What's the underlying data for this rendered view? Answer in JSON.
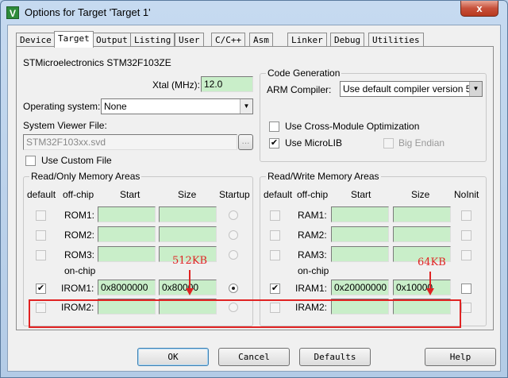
{
  "window": {
    "title": "Options for Target 'Target 1'",
    "close_glyph": "x"
  },
  "tabs": [
    {
      "label": "Device"
    },
    {
      "label": "Target"
    },
    {
      "label": "Output"
    },
    {
      "label": "Listing"
    },
    {
      "label": "User"
    },
    {
      "label": "C/C++"
    },
    {
      "label": "Asm"
    },
    {
      "label": "Linker"
    },
    {
      "label": "Debug"
    },
    {
      "label": "Utilities"
    }
  ],
  "active_tab": "Target",
  "device": {
    "name": "STMicroelectronics STM32F103ZE",
    "xtal_label": "Xtal (MHz):",
    "xtal_value": "12.0"
  },
  "os": {
    "label": "Operating system:",
    "value": "None"
  },
  "svd": {
    "label": "System Viewer File:",
    "value": "STM32F103xx.svd",
    "browse": "...",
    "custom_label": "Use Custom File"
  },
  "codegen": {
    "title": "Code Generation",
    "compiler_label": "ARM Compiler:",
    "compiler_value": "Use default compiler version 5",
    "cross_module_label": "Use Cross-Module Optimization",
    "microlib_label": "Use MicroLIB",
    "big_endian_label": "Big Endian"
  },
  "rom": {
    "title": "Read/Only Memory Areas",
    "headers": {
      "default": "default",
      "offchip": "off-chip",
      "start": "Start",
      "size": "Size",
      "startup": "Startup"
    },
    "onchip_label": "on-chip",
    "rows": [
      {
        "name": "ROM1:",
        "start": "",
        "size": "",
        "default": false,
        "startup": false
      },
      {
        "name": "ROM2:",
        "start": "",
        "size": "",
        "default": false,
        "startup": false
      },
      {
        "name": "ROM3:",
        "start": "",
        "size": "",
        "default": false,
        "startup": false
      },
      {
        "name": "IROM1:",
        "start": "0x8000000",
        "size": "0x80000",
        "default": true,
        "startup": true
      },
      {
        "name": "IROM2:",
        "start": "",
        "size": "",
        "default": false,
        "startup": false
      }
    ]
  },
  "ram": {
    "title": "Read/Write Memory Areas",
    "headers": {
      "default": "default",
      "offchip": "off-chip",
      "start": "Start",
      "size": "Size",
      "noinit": "NoInit"
    },
    "onchip_label": "on-chip",
    "rows": [
      {
        "name": "RAM1:",
        "start": "",
        "size": "",
        "default": false,
        "noinit": false
      },
      {
        "name": "RAM2:",
        "start": "",
        "size": "",
        "default": false,
        "noinit": false
      },
      {
        "name": "RAM3:",
        "start": "",
        "size": "",
        "default": false,
        "noinit": false
      },
      {
        "name": "IRAM1:",
        "start": "0x20000000",
        "size": "0x10000",
        "default": true,
        "noinit": false
      },
      {
        "name": "IRAM2:",
        "start": "",
        "size": "",
        "default": false,
        "noinit": false
      }
    ]
  },
  "annotations": {
    "rom_size": "512KB",
    "ram_size": "64KB",
    "color": "#e02222"
  },
  "buttons": {
    "ok": "OK",
    "cancel": "Cancel",
    "defaults": "Defaults",
    "help": "Help"
  },
  "colors": {
    "field_green": "#c9eec9",
    "dialog_bg": "#f0f0f0"
  }
}
